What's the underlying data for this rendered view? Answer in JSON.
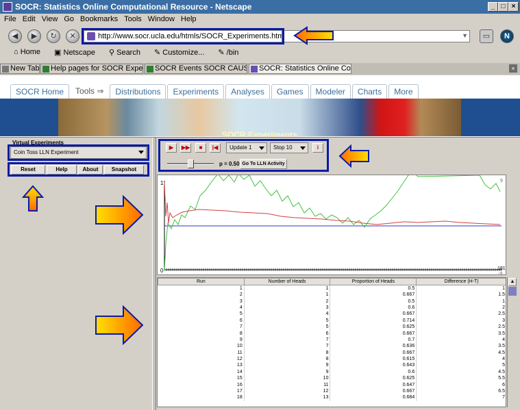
{
  "window": {
    "title": "SOCR: Statistics Online Computational Resource - Netscape"
  },
  "menu": [
    "File",
    "Edit",
    "View",
    "Go",
    "Bookmarks",
    "Tools",
    "Window",
    "Help"
  ],
  "address": {
    "url": "http://www.socr.ucla.edu/htmls/SOCR_Experiments.html"
  },
  "bookmarks": [
    "Home",
    "Netscape",
    "Search",
    "Customize...",
    "/bin"
  ],
  "tabs": [
    {
      "label": "New Tab"
    },
    {
      "label": "Help pages for SOCR Exper..."
    },
    {
      "label": "SOCR Events SOCR CAUSE..."
    },
    {
      "label": "SOCR: Statistics Online Co..."
    }
  ],
  "site_nav": [
    "SOCR Home",
    "Tools ⇒",
    "Distributions",
    "Experiments",
    "Analyses",
    "Games",
    "Modeler",
    "Charts",
    "More"
  ],
  "banner": {
    "caption": "SOCR Experiments"
  },
  "left_panel": {
    "section_title": "Virtual Experiments",
    "experiment": "Coin Toss LLN Experiment",
    "buttons": [
      "Reset",
      "Help",
      "About",
      "Snapshot"
    ]
  },
  "controls": {
    "update": "Update 1",
    "stop": "Stop 10",
    "p_label": "p = 0.50",
    "lln_button": "Go To LLN Activity",
    "p_value": 0.5
  },
  "graph": {
    "y_top_label": "1",
    "y_bottom_label": "0",
    "right_top_label": "9",
    "right_bottom_label": "-9",
    "x_end_label": "181"
  },
  "table": {
    "headers": [
      "Run",
      "Number of Heads",
      "Proportion of Heads",
      "Difference (H-T)"
    ],
    "rows": [
      [
        "1",
        "1",
        "0.5",
        "1"
      ],
      [
        "2",
        "1",
        "0.667",
        "1.5"
      ],
      [
        "3",
        "2",
        "0.5",
        "1"
      ],
      [
        "4",
        "3",
        "0.6",
        "2"
      ],
      [
        "5",
        "4",
        "0.667",
        "2.5"
      ],
      [
        "6",
        "5",
        "0.714",
        "3"
      ],
      [
        "7",
        "5",
        "0.625",
        "2.5"
      ],
      [
        "8",
        "6",
        "0.667",
        "3.5"
      ],
      [
        "9",
        "7",
        "0.7",
        "4"
      ],
      [
        "10",
        "7",
        "0.636",
        "3.5"
      ],
      [
        "11",
        "8",
        "0.667",
        "4.5"
      ],
      [
        "12",
        "8",
        "0.615",
        "4"
      ],
      [
        "13",
        "9",
        "0.643",
        "5"
      ],
      [
        "14",
        "9",
        "0.6",
        "4.5"
      ],
      [
        "15",
        "10",
        "0.625",
        "5.5"
      ],
      [
        "16",
        "11",
        "0.647",
        "6"
      ],
      [
        "17",
        "12",
        "0.667",
        "6.5"
      ],
      [
        "18",
        "13",
        "0.684",
        "7"
      ]
    ]
  },
  "colors": {
    "highlight": "#0a1aa8",
    "arrow_start": "#ffe000",
    "arrow_end": "#ff6a00",
    "proportion_line": "#d04040",
    "difference_line": "#40c040",
    "reference_line": "#3030d0"
  }
}
